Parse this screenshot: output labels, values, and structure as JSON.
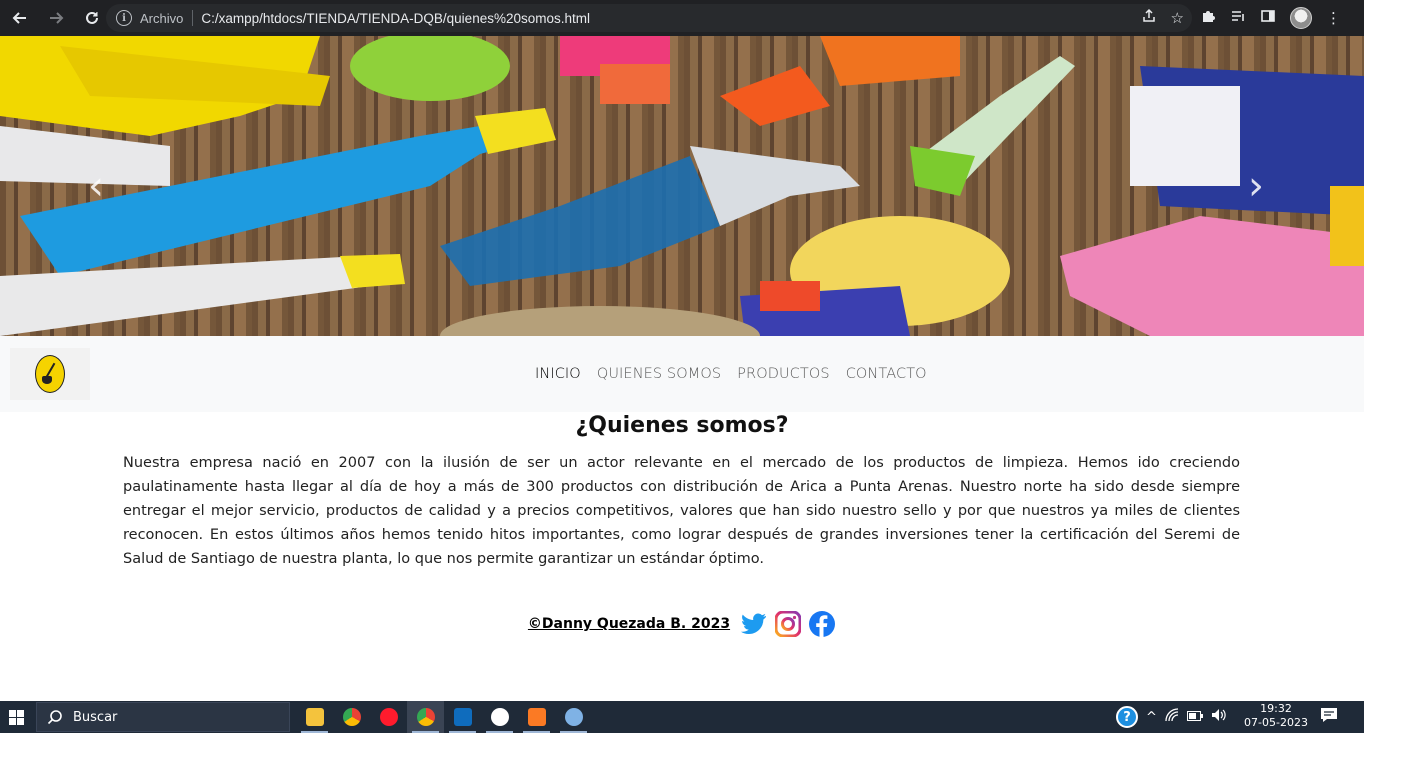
{
  "browser": {
    "scheme_label": "Archivo",
    "url": "C:/xampp/htdocs/TIENDA/TIENDA-DQB/quienes%20somos.html",
    "icons": [
      "back-icon",
      "forward-icon",
      "reload-icon",
      "info-icon",
      "share-icon",
      "star-icon",
      "extensions-icon",
      "reading-list-icon",
      "sidebar-icon",
      "profile-avatar",
      "menu-icon"
    ]
  },
  "carousel": {
    "prev_glyph": "‹",
    "next_glyph": "›"
  },
  "navbar": {
    "items": [
      {
        "label": "INICIO",
        "active": true
      },
      {
        "label": "QUIENES SOMOS",
        "active": false
      },
      {
        "label": "PRODUCTOS",
        "active": false
      },
      {
        "label": "CONTACTO",
        "active": false
      }
    ]
  },
  "content": {
    "title": "¿Quienes somos?",
    "body": "Nuestra empresa nació en 2007 con la ilusión de ser un actor relevante en el mercado de los productos de limpieza. Hemos ido creciendo paulatinamente hasta llegar al día de hoy a más de 300 productos con distribución de Arica a Punta Arenas. Nuestro norte ha sido desde siempre entregar el mejor servicio, productos de calidad y a precios competitivos, valores que han sido nuestro sello y por que nuestros ya miles de clientes reconocen. En estos últimos años hemos tenido hitos importantes, como lograr después de grandes inversiones tener la certificación del Seremi de Salud de Santiago de nuestra planta, lo que nos permite garantizar un estándar óptimo."
  },
  "footer": {
    "copyright": "©Danny Quezada B. 2023",
    "social": [
      "twitter-icon",
      "instagram-icon",
      "facebook-icon"
    ],
    "colors": {
      "twitter": "#1d9bf0",
      "facebook": "#1877f2"
    }
  },
  "taskbar": {
    "search_label": "Buscar",
    "time": "19:32",
    "date": "07-05-2023"
  }
}
